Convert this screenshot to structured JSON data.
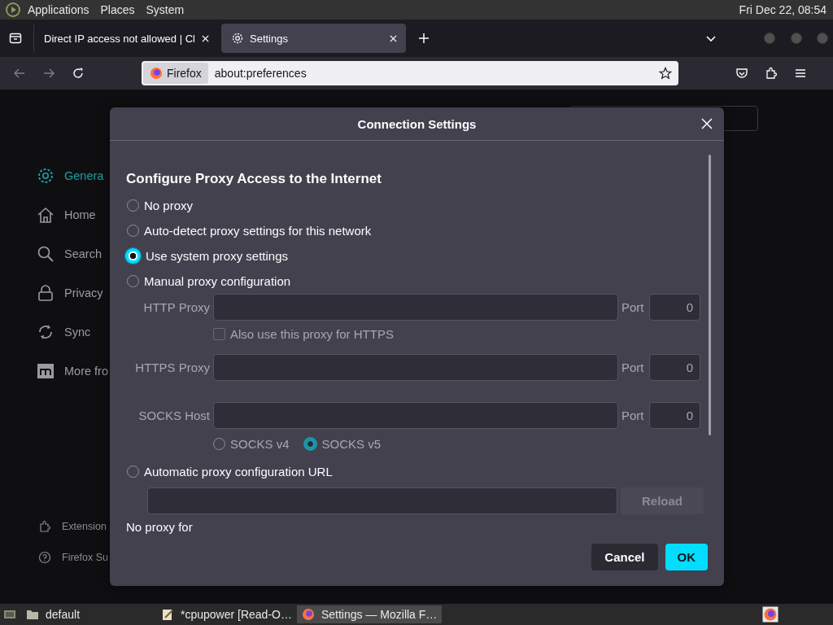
{
  "top_panel": {
    "menus": [
      "Applications",
      "Places",
      "System"
    ],
    "clock": "Fri Dec 22, 08:54"
  },
  "tabs": [
    {
      "title": "Direct IP access not allowed | Cl",
      "selected": false,
      "kind": "page"
    },
    {
      "title": "Settings",
      "selected": true,
      "kind": "settings"
    }
  ],
  "address_bar": {
    "identity": "Firefox",
    "url": "about:preferences"
  },
  "sidebar": {
    "items": [
      {
        "label": "Genera",
        "selected": true
      },
      {
        "label": "Home",
        "selected": false
      },
      {
        "label": "Search",
        "selected": false
      },
      {
        "label": "Privacy",
        "selected": false
      },
      {
        "label": "Sync",
        "selected": false
      },
      {
        "label": "More fro",
        "selected": false
      }
    ],
    "footer_items": [
      {
        "label": "Extension"
      },
      {
        "label": "Firefox Su"
      }
    ]
  },
  "dialog": {
    "title": "Connection Settings",
    "heading": "Configure Proxy Access to the Internet",
    "proxy_options": [
      {
        "label": "No proxy",
        "selected": false
      },
      {
        "label": "Auto-detect proxy settings for this network",
        "selected": false
      },
      {
        "label": "Use system proxy settings",
        "selected": true
      },
      {
        "label": "Manual proxy configuration",
        "selected": false
      },
      {
        "label": "Automatic proxy configuration URL",
        "selected": false
      }
    ],
    "manual": {
      "disabled": true,
      "http": {
        "label": "HTTP Proxy",
        "port_label": "Port",
        "port": "0"
      },
      "also_https": {
        "label": "Also use this proxy for HTTPS",
        "checked": false
      },
      "https": {
        "label": "HTTPS Proxy",
        "port_label": "Port",
        "port": "0"
      },
      "socks": {
        "label": "SOCKS Host",
        "port_label": "Port",
        "port": "0"
      },
      "socks_versions": [
        {
          "label": "SOCKS v4",
          "selected": false
        },
        {
          "label": "SOCKS v5",
          "selected": true
        }
      ]
    },
    "reload": {
      "label": "Reload",
      "disabled": true
    },
    "no_proxy_label": "No proxy for",
    "buttons": [
      {
        "label": "Cancel",
        "kind": "secondary"
      },
      {
        "label": "OK",
        "kind": "primary"
      }
    ]
  },
  "taskbar": {
    "items": [
      {
        "label": "default",
        "selected": false
      },
      {
        "label": "*cpupower [Read-O…",
        "selected": false
      },
      {
        "label": "Settings — Mozilla F…",
        "selected": true
      }
    ]
  }
}
